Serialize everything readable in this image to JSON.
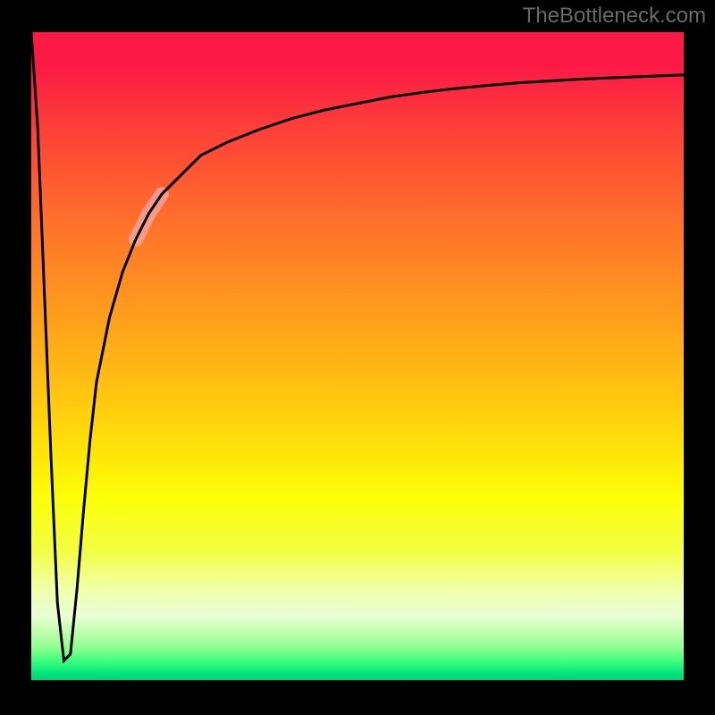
{
  "attribution": "TheBottleneck.com",
  "chart_data": {
    "type": "line",
    "title": "",
    "xlabel": "",
    "ylabel": "",
    "xlim": [
      0,
      100
    ],
    "ylim": [
      0,
      100
    ],
    "grid": false,
    "series": [
      {
        "name": "bottleneck-curve",
        "x": [
          0,
          1,
          2,
          3,
          4,
          5,
          6,
          7,
          8,
          9,
          10,
          12,
          14,
          16,
          18,
          20,
          23,
          26,
          30,
          35,
          40,
          45,
          50,
          55,
          60,
          65,
          70,
          75,
          80,
          85,
          90,
          95,
          100
        ],
        "y": [
          100,
          85,
          60,
          35,
          12,
          3,
          4,
          14,
          26,
          37,
          46,
          56,
          63,
          68,
          72,
          75,
          78,
          81,
          83,
          85,
          86.7,
          88,
          89,
          90,
          90.7,
          91.3,
          91.8,
          92.2,
          92.5,
          92.8,
          93.0,
          93.2,
          93.4
        ]
      }
    ],
    "highlight_segment": {
      "x_start": 16,
      "x_end": 22
    },
    "background_gradient": {
      "direction": "vertical",
      "stops": [
        {
          "pos": 0.0,
          "color": "#fb1946"
        },
        {
          "pos": 0.28,
          "color": "#ff6c2c"
        },
        {
          "pos": 0.52,
          "color": "#ffb814"
        },
        {
          "pos": 0.72,
          "color": "#fcff08"
        },
        {
          "pos": 0.9,
          "color": "#e9ffd5"
        },
        {
          "pos": 1.0,
          "color": "#00d67a"
        }
      ]
    }
  }
}
